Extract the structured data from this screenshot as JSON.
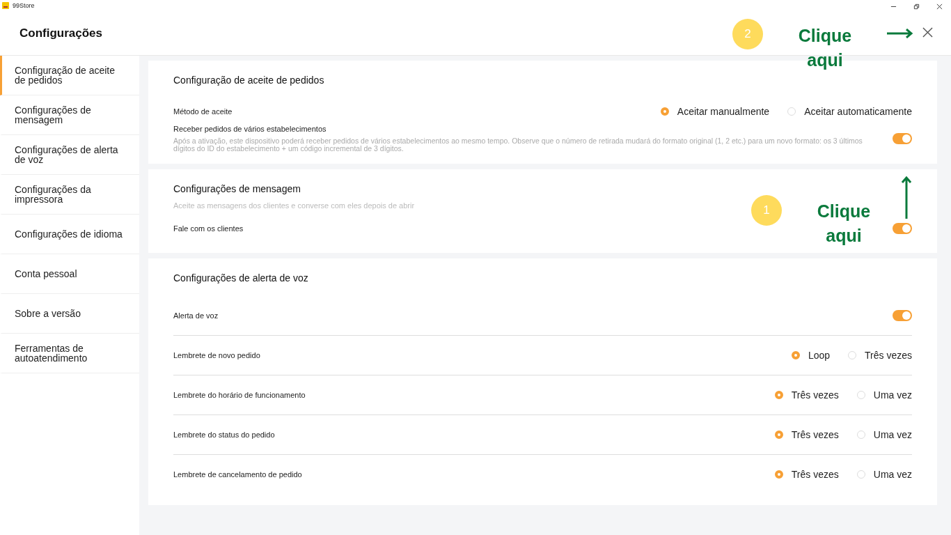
{
  "window": {
    "title": "99Store"
  },
  "header": {
    "title": "Configurações"
  },
  "sidebar": {
    "items": [
      {
        "label": "Configuração de aceite de pedidos",
        "selected": true
      },
      {
        "label": "Configurações de mensagem",
        "selected": false
      },
      {
        "label": "Configurações de alerta de voz",
        "selected": false
      },
      {
        "label": "Configurações da impressora",
        "selected": false
      },
      {
        "label": "Configurações de idioma",
        "selected": false
      },
      {
        "label": "Conta pessoal",
        "selected": false
      },
      {
        "label": "Sobre a versão",
        "selected": false
      },
      {
        "label": "Ferramentas de autoatendimento",
        "selected": false
      }
    ]
  },
  "sections": [
    {
      "title": "Configuração de aceite de pedidos",
      "dividers": false,
      "rows": [
        {
          "kind": "radio",
          "label": "Método de aceite",
          "options": [
            {
              "label": "Aceitar manualmente",
              "selected": true
            },
            {
              "label": "Aceitar automaticamente",
              "selected": false
            }
          ]
        },
        {
          "kind": "toggle",
          "label": "Receber pedidos de vários estabelecimentos",
          "description": "Após a ativação, este dispositivo poderá receber pedidos de vários estabelecimentos ao mesmo tempo. Observe que o número de retirada mudará do formato original (1, 2 etc.) para um novo formato: os 3 últimos dígitos do ID do estabelecimento + um código incremental de 3 dígitos.",
          "on": true
        }
      ]
    },
    {
      "title": "Configurações de mensagem",
      "description": "Aceite as mensagens dos clientes e converse com eles depois de abrir",
      "dividers": false,
      "rows": [
        {
          "kind": "toggle",
          "label": "Fale com os clientes",
          "on": true
        }
      ]
    },
    {
      "title": "Configurações de alerta de voz",
      "dividers": true,
      "rows": [
        {
          "kind": "toggle",
          "label": "Alerta de voz",
          "on": true
        },
        {
          "kind": "radio",
          "label": "Lembrete de novo pedido",
          "options": [
            {
              "label": "Loop",
              "selected": true
            },
            {
              "label": "Três vezes",
              "selected": false
            }
          ]
        },
        {
          "kind": "radio",
          "label": "Lembrete do horário de funcionamento",
          "options": [
            {
              "label": "Três vezes",
              "selected": true
            },
            {
              "label": "Uma vez",
              "selected": false
            }
          ]
        },
        {
          "kind": "radio",
          "label": "Lembrete do status do pedido",
          "options": [
            {
              "label": "Três vezes",
              "selected": true
            },
            {
              "label": "Uma vez",
              "selected": false
            }
          ]
        },
        {
          "kind": "radio",
          "label": "Lembrete de cancelamento de pedido",
          "options": [
            {
              "label": "Três vezes",
              "selected": true
            },
            {
              "label": "Uma vez",
              "selected": false
            }
          ]
        }
      ]
    }
  ],
  "annotations": [
    {
      "badge": "2",
      "text": "Clique aqui"
    },
    {
      "badge": "1",
      "text": "Clique aqui"
    }
  ]
}
